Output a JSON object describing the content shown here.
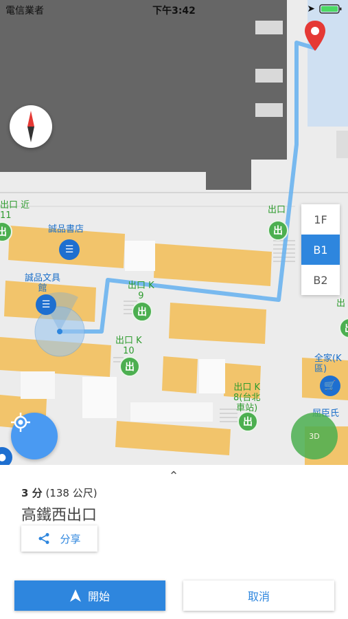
{
  "status": {
    "carrier": "電信業者",
    "time": "下午3:42"
  },
  "map": {
    "pois": {
      "eslite_books": "誠品書店",
      "eslite_stationery": "誠品文具\n館",
      "exit_k9": "出口 K\n9",
      "exit_k10": "出口 K\n10",
      "exit_k8": "出口 K\n8(台北\n車站)",
      "exit_top": "出口",
      "exit_left": "出口 近\n11",
      "familymart": "全家(K\n區)",
      "watsons": "屈臣氏",
      "exit_right": "出",
      "badge_exit": "出口"
    }
  },
  "floors": [
    {
      "label": "1F",
      "active": false
    },
    {
      "label": "B1",
      "active": true
    },
    {
      "label": "B2",
      "active": false
    }
  ],
  "buttons": {
    "mode3d": "3D"
  },
  "sheet": {
    "duration": "3 分",
    "distance": "(138 公尺)",
    "destination": "高鐵西出口",
    "share": "分享",
    "start": "開始",
    "cancel": "取消"
  },
  "colors": {
    "accent": "#2e86de",
    "route": "#6cb4f0",
    "exit_green": "#4caf50",
    "shop": "#f2c46b"
  }
}
